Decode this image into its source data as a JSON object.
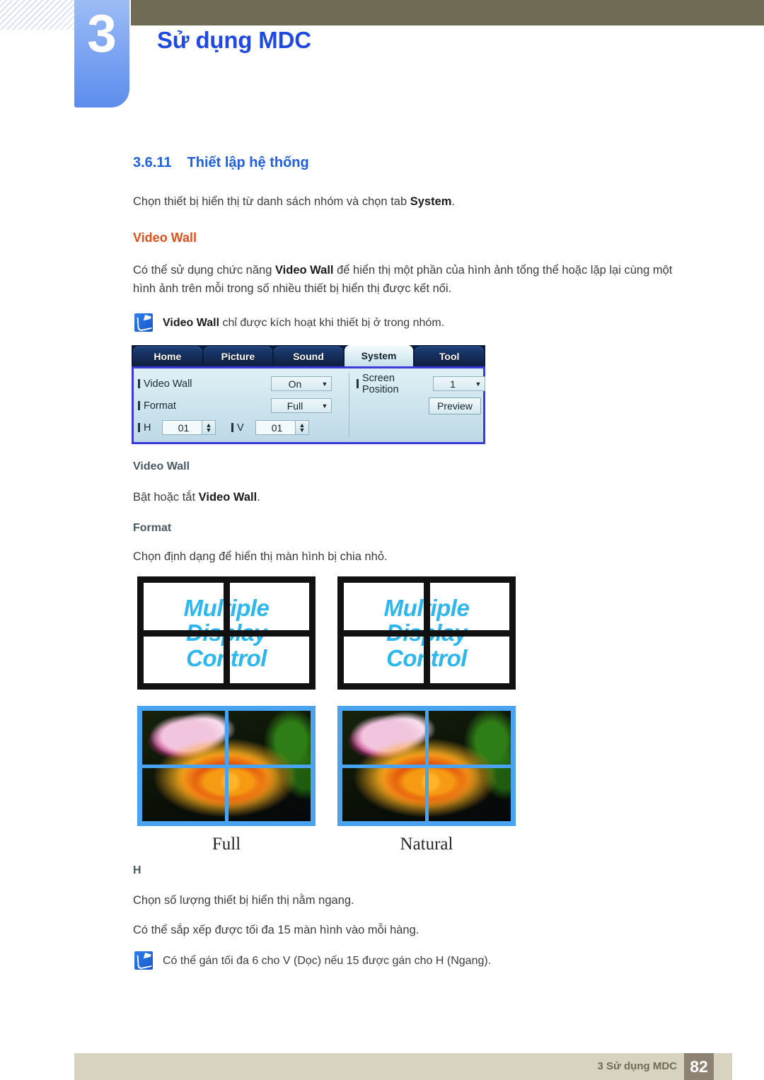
{
  "header": {
    "chapter_number": "3",
    "chapter_title": "Sử dụng MDC"
  },
  "section": {
    "number": "3.6.11",
    "title": "Thiết lập hệ thống",
    "intro_prefix": "Chọn thiết bị hiển thị từ danh sách nhóm và chọn tab ",
    "intro_bold": "System",
    "intro_suffix": "."
  },
  "video_wall": {
    "heading": "Video Wall",
    "desc_line1_a": "Có thể sử dụng chức năng ",
    "desc_line1_bold": "Video Wall",
    "desc_line1_b": " để hiển thị một phần của hình ảnh tổng thể hoặc lặp lại cùng",
    "desc_line2": "một hình ảnh trên mỗi trong số nhiều thiết bị hiển thị được kết nối.",
    "note_bold": "Video Wall",
    "note_rest": " chỉ được kích hoạt khi thiết bị ở trong nhóm."
  },
  "mdc_dialog": {
    "tabs": [
      {
        "label": "Home",
        "active": false
      },
      {
        "label": "Picture",
        "active": false
      },
      {
        "label": "Sound",
        "active": false
      },
      {
        "label": "System",
        "active": true
      },
      {
        "label": "Tool",
        "active": false
      }
    ],
    "fields": {
      "video_wall_label": "Video Wall",
      "video_wall_value": "On",
      "format_label": "Format",
      "format_value": "Full",
      "h_label": "H",
      "h_value": "01",
      "v_label": "V",
      "v_value": "01",
      "screen_position_label": "Screen Position",
      "screen_position_value": "1",
      "preview_button": "Preview"
    }
  },
  "sub_sections": {
    "video_wall_title": "Video Wall",
    "video_wall_body_a": "Bật hoặc tắt ",
    "video_wall_body_bold": "Video Wall",
    "video_wall_body_b": ".",
    "format_title": "Format",
    "format_body": "Chọn định dạng để hiển thị màn hình bị chia nhỏ.",
    "h_title": "H",
    "h_body_line1": "Chọn số lượng thiết bị hiển thị nằm ngang.",
    "h_body_line2": "Có thể sắp xếp được tối đa 15 màn hình vào mỗi hàng.",
    "h_note": "Có thể gán tối đa 6 cho V (Dọc) nếu 15 được gán cho H (Ngang)."
  },
  "diagrams": {
    "wall_text_line1": "Multiple",
    "wall_text_line2": "Display",
    "wall_text_line3": "Control",
    "mode_full": "Full",
    "mode_natural": "Natural"
  },
  "footer": {
    "label": "3 Sử dụng MDC",
    "page_number": "82"
  },
  "colors": {
    "accent_blue": "#1f49e0",
    "heading_blue": "#1f5fe0",
    "orange": "#e0521b",
    "slate": "#4a5a63",
    "olive": "#6f6b54",
    "footer_beige": "#d8d2c0",
    "footer_page_bg": "#8e8274",
    "wall_text_cyan": "#2eb6ef",
    "wall_border_blue": "#4aa3f0"
  }
}
